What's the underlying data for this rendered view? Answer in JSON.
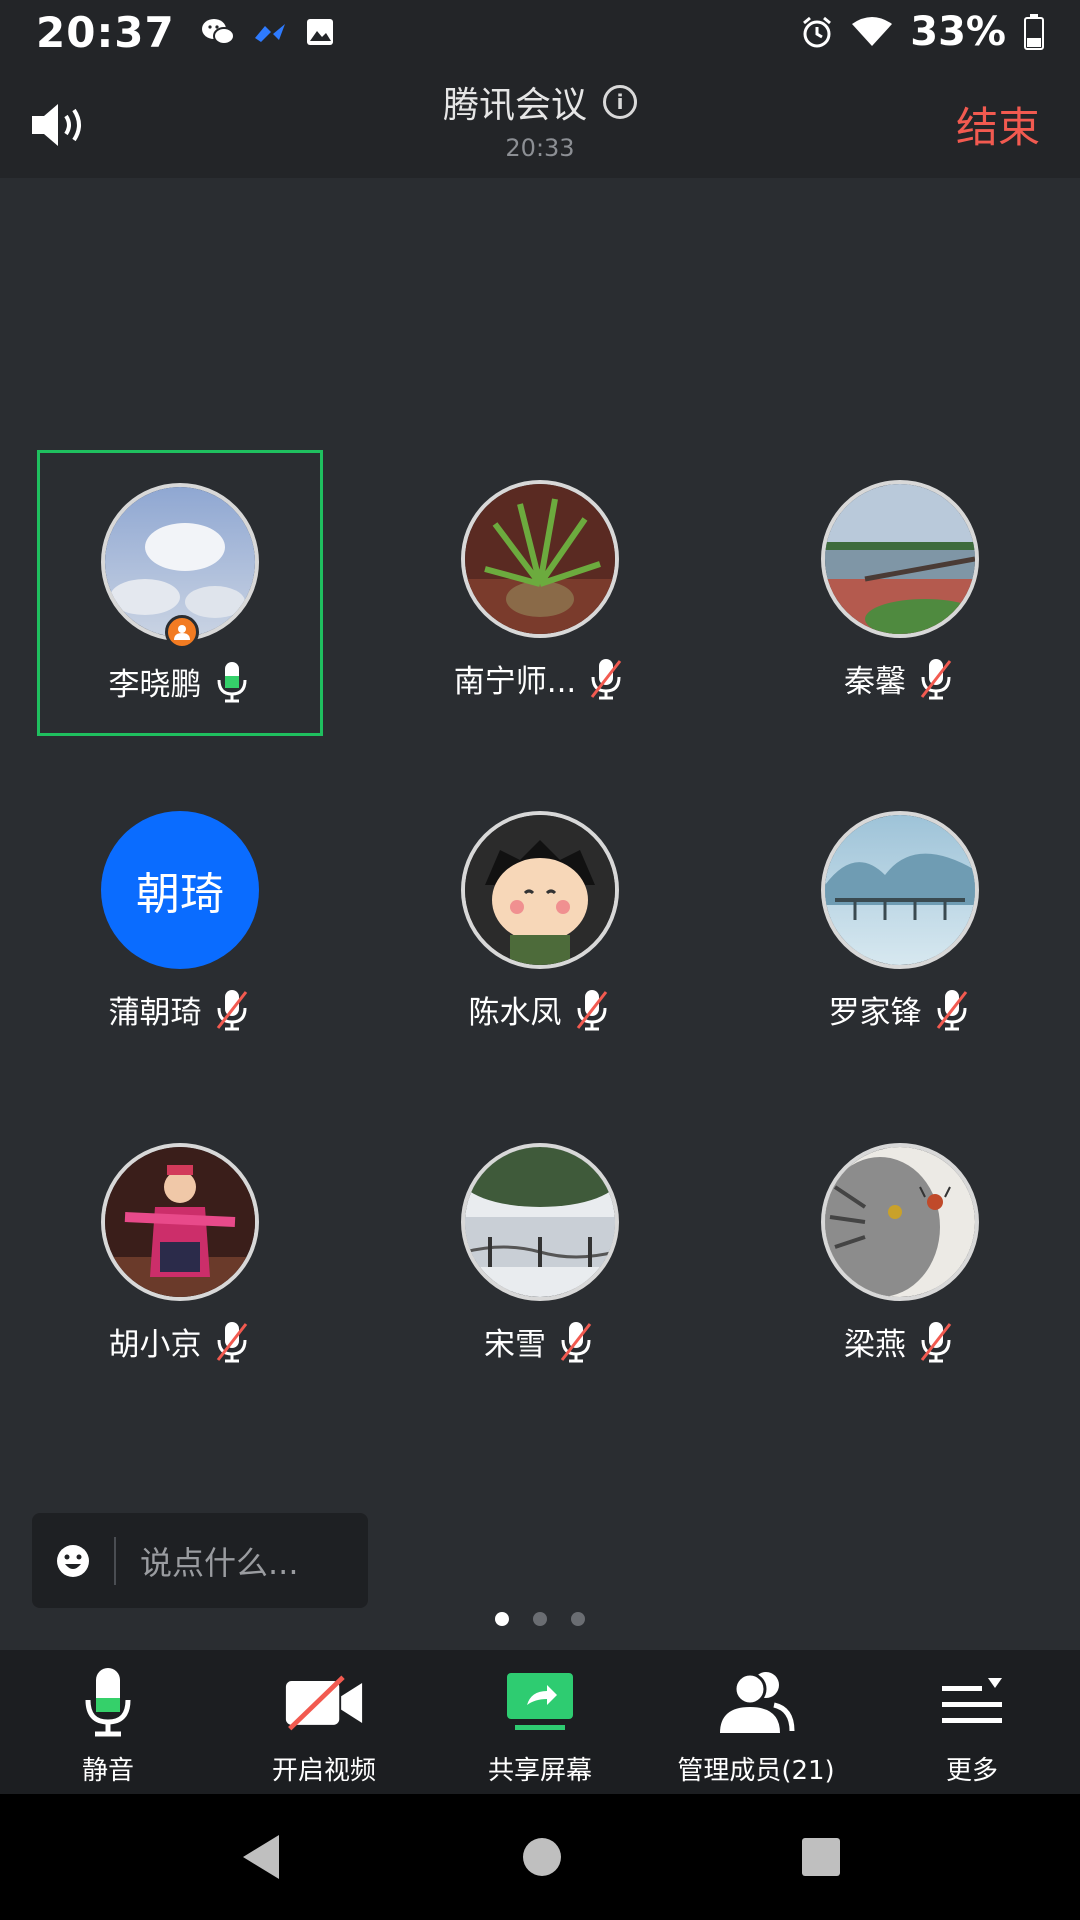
{
  "status_bar": {
    "time": "20:37",
    "battery": "33%",
    "icons_left": [
      "wechat-icon",
      "feishu-icon",
      "gallery-icon"
    ],
    "icons_right": [
      "alarm-icon",
      "wifi-icon",
      "battery-icon"
    ]
  },
  "header": {
    "title": "腾讯会议",
    "subtitle": "20:33",
    "end_label": "结束"
  },
  "participants": [
    {
      "name": "李晓鹏",
      "mic": "on",
      "host": true,
      "avatar": "sky-photo"
    },
    {
      "name": "南宁师...",
      "mic": "muted",
      "avatar": "plant-photo"
    },
    {
      "name": "秦馨",
      "mic": "muted",
      "avatar": "lake-photo"
    },
    {
      "name": "蒲朝琦",
      "mic": "muted",
      "avatar_text": "朝琦"
    },
    {
      "name": "陈水凤",
      "mic": "muted",
      "avatar": "cartoon-girl-photo"
    },
    {
      "name": "罗家锋",
      "mic": "muted",
      "avatar": "misty-bridge-photo"
    },
    {
      "name": "胡小京",
      "mic": "muted",
      "avatar": "dancer-photo"
    },
    {
      "name": "宋雪",
      "mic": "muted",
      "avatar": "lakeside-tree-photo"
    },
    {
      "name": "梁燕",
      "mic": "muted",
      "avatar": "cat-photo"
    }
  ],
  "chat": {
    "placeholder": "说点什么..."
  },
  "pager": {
    "pages": 3,
    "current": 1
  },
  "toolbar": {
    "mute_label": "静音",
    "video_label": "开启视频",
    "share_label": "共享屏幕",
    "members_label": "管理成员(21)",
    "more_label": "更多"
  },
  "colors": {
    "accent_green": "#1fbf5f",
    "end_red": "#f25a50",
    "avatar_blue": "#0a6cff",
    "host_orange": "#f27b22"
  }
}
